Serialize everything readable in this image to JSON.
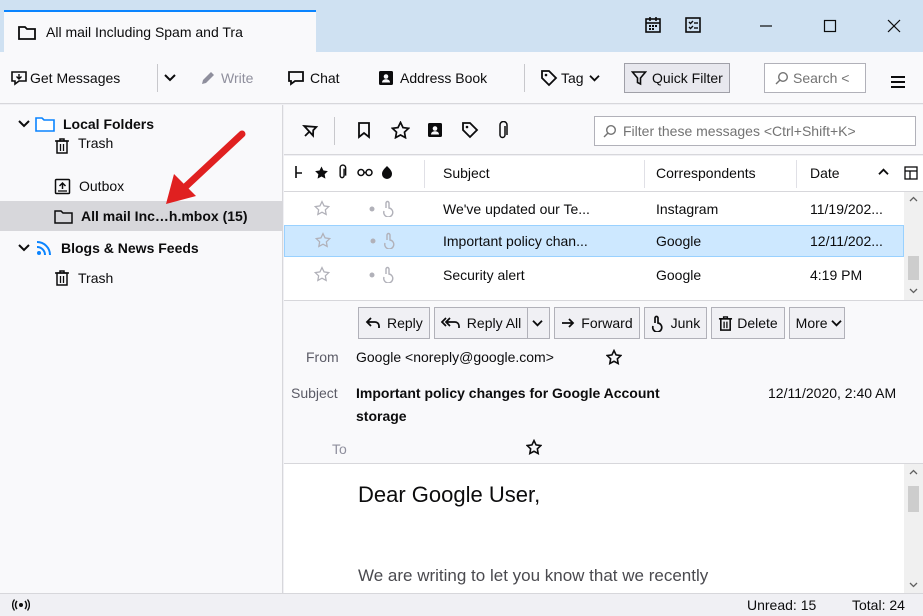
{
  "window": {
    "tab_title": "All mail Including Spam and Tra"
  },
  "toolbar": {
    "get_messages": "Get Messages",
    "write": "Write",
    "chat": "Chat",
    "address_book": "Address Book",
    "tag": "Tag",
    "quick_filter": "Quick Filter",
    "search_placeholder": "Search <"
  },
  "folders": {
    "local_folders": "Local Folders",
    "trash": "Trash",
    "outbox": "Outbox",
    "all_mail": "All mail Inc…h.mbox (15)",
    "blogs": "Blogs & News Feeds",
    "blogs_trash": "Trash"
  },
  "filter": {
    "placeholder": "Filter these messages <Ctrl+Shift+K>"
  },
  "columns": {
    "subject": "Subject",
    "correspondents": "Correspondents",
    "date": "Date"
  },
  "messages": [
    {
      "subject": "We've updated our Te...",
      "correspondent": "Instagram",
      "date": "11/19/202..."
    },
    {
      "subject": "Important policy chan...",
      "correspondent": "Google",
      "date": "12/11/202..."
    },
    {
      "subject": "Security alert",
      "correspondent": "Google",
      "date": "4:19 PM"
    }
  ],
  "actions": {
    "reply": "Reply",
    "reply_all": "Reply All",
    "forward": "Forward",
    "junk": "Junk",
    "delete": "Delete",
    "more": "More"
  },
  "header": {
    "from_label": "From",
    "from_value": "Google <noreply@google.com>",
    "subject_label": "Subject",
    "subject_line1": "Important policy changes for Google Account",
    "subject_line2": "storage",
    "date": "12/11/2020, 2:40 AM",
    "to_label": "To"
  },
  "body": {
    "greeting": "Dear Google User,",
    "line1": "We are writing to let you know that we recently"
  },
  "status": {
    "unread": "Unread: 15",
    "total": "Total: 24"
  },
  "colors": {
    "titlebar": "#cfe1f2",
    "accent": "#0a84ff",
    "selection": "#cde8ff",
    "arrow": "#e02020"
  }
}
